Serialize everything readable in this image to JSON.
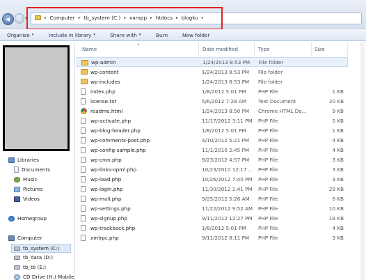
{
  "address": {
    "recent_glyph": "▾",
    "crumbs": [
      "Computer",
      "tb_system (C:)",
      "xampp",
      "htdocs",
      "blogku"
    ],
    "separator": "▸"
  },
  "toolbar": {
    "organize": "Organize",
    "include": "Include in library",
    "share": "Share with",
    "burn": "Burn",
    "new_folder": "New folder",
    "caret": "▾"
  },
  "nav": {
    "libraries": "Libraries",
    "documents": "Documents",
    "music": "Music",
    "pictures": "Pictures",
    "videos": "Videos",
    "homegroup": "Homegroup",
    "computer": "Computer",
    "drive_c": "tb_system (C:)",
    "drive_d": "tb_data (D:)",
    "drive_e": "tb_tb (E:)",
    "drive_h": "CD Drive (H:) Mobile"
  },
  "columns": {
    "name": "Name",
    "date": "Date modified",
    "type": "Type",
    "size": "Size",
    "sort_glyph": "▴"
  },
  "files": [
    {
      "name": "wp-admin",
      "date": "1/24/2013 8:53 PM",
      "type": "File folder",
      "size": "",
      "kind": "folder"
    },
    {
      "name": "wp-content",
      "date": "1/24/2013 8:53 PM",
      "type": "File folder",
      "size": "",
      "kind": "folder"
    },
    {
      "name": "wp-includes",
      "date": "1/24/2013 8:53 PM",
      "type": "File folder",
      "size": "",
      "kind": "folder"
    },
    {
      "name": "index.php",
      "date": "1/8/2012 5:01 PM",
      "type": "PHP File",
      "size": "1 KB",
      "kind": "file"
    },
    {
      "name": "license.txt",
      "date": "5/6/2012 7:28 AM",
      "type": "Text Document",
      "size": "20 KB",
      "kind": "file"
    },
    {
      "name": "readme.html",
      "date": "1/24/2013 8:50 PM",
      "type": "Chrome HTML Do...",
      "size": "9 KB",
      "kind": "chrome"
    },
    {
      "name": "wp-activate.php",
      "date": "11/17/2012 3:11 PM",
      "type": "PHP File",
      "size": "5 KB",
      "kind": "file"
    },
    {
      "name": "wp-blog-header.php",
      "date": "1/8/2012 5:01 PM",
      "type": "PHP File",
      "size": "1 KB",
      "kind": "file"
    },
    {
      "name": "wp-comments-post.php",
      "date": "4/10/2012 5:21 PM",
      "type": "PHP File",
      "size": "4 KB",
      "kind": "file"
    },
    {
      "name": "wp-config-sample.php",
      "date": "11/1/2010 2:45 PM",
      "type": "PHP File",
      "size": "4 KB",
      "kind": "file"
    },
    {
      "name": "wp-cron.php",
      "date": "9/23/2012 4:57 PM",
      "type": "PHP File",
      "size": "3 KB",
      "kind": "file"
    },
    {
      "name": "wp-links-opml.php",
      "date": "10/23/2010 12:17 ...",
      "type": "PHP File",
      "size": "3 KB",
      "kind": "file"
    },
    {
      "name": "wp-load.php",
      "date": "10/26/2012 7:40 PM",
      "type": "PHP File",
      "size": "3 KB",
      "kind": "file"
    },
    {
      "name": "wp-login.php",
      "date": "11/30/2012 1:41 PM",
      "type": "PHP File",
      "size": "29 KB",
      "kind": "file"
    },
    {
      "name": "wp-mail.php",
      "date": "9/25/2012 5:26 AM",
      "type": "PHP File",
      "size": "8 KB",
      "kind": "file"
    },
    {
      "name": "wp-settings.php",
      "date": "11/22/2012 9:52 AM",
      "type": "PHP File",
      "size": "10 KB",
      "kind": "file"
    },
    {
      "name": "wp-signup.php",
      "date": "9/11/2012 12:27 PM",
      "type": "PHP File",
      "size": "18 KB",
      "kind": "file"
    },
    {
      "name": "wp-trackback.php",
      "date": "1/8/2012 5:01 PM",
      "type": "PHP File",
      "size": "4 KB",
      "kind": "file"
    },
    {
      "name": "xmlrpc.php",
      "date": "9/11/2012 8:11 PM",
      "type": "PHP File",
      "size": "3 KB",
      "kind": "file"
    }
  ]
}
